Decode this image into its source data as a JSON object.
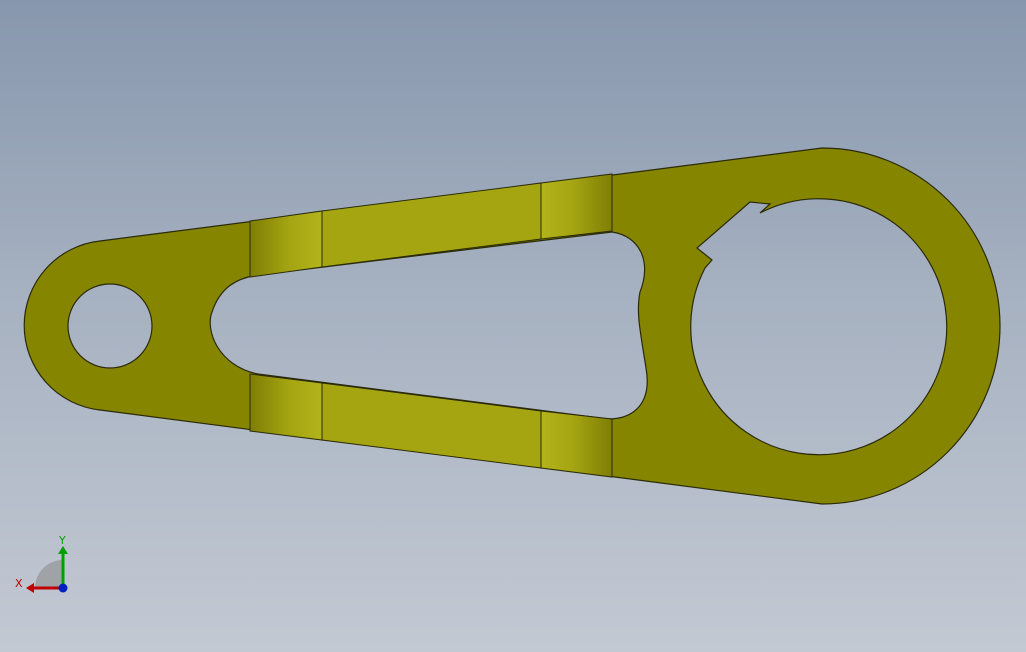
{
  "viewport": {
    "background_top": "#8797ad",
    "background_bottom": "#c3c9d3"
  },
  "part": {
    "face_color": "#868500",
    "chamfer_color": "#a5a512",
    "chamfer_shade": "#7f7e05",
    "edge_color": "#2a2a0a"
  },
  "triad": {
    "x_label": "X",
    "y_label": "Y",
    "x_color": "#c00000",
    "y_color": "#00a000",
    "z_color": "#0020c0",
    "icon": "coordinate-triad-icon"
  }
}
